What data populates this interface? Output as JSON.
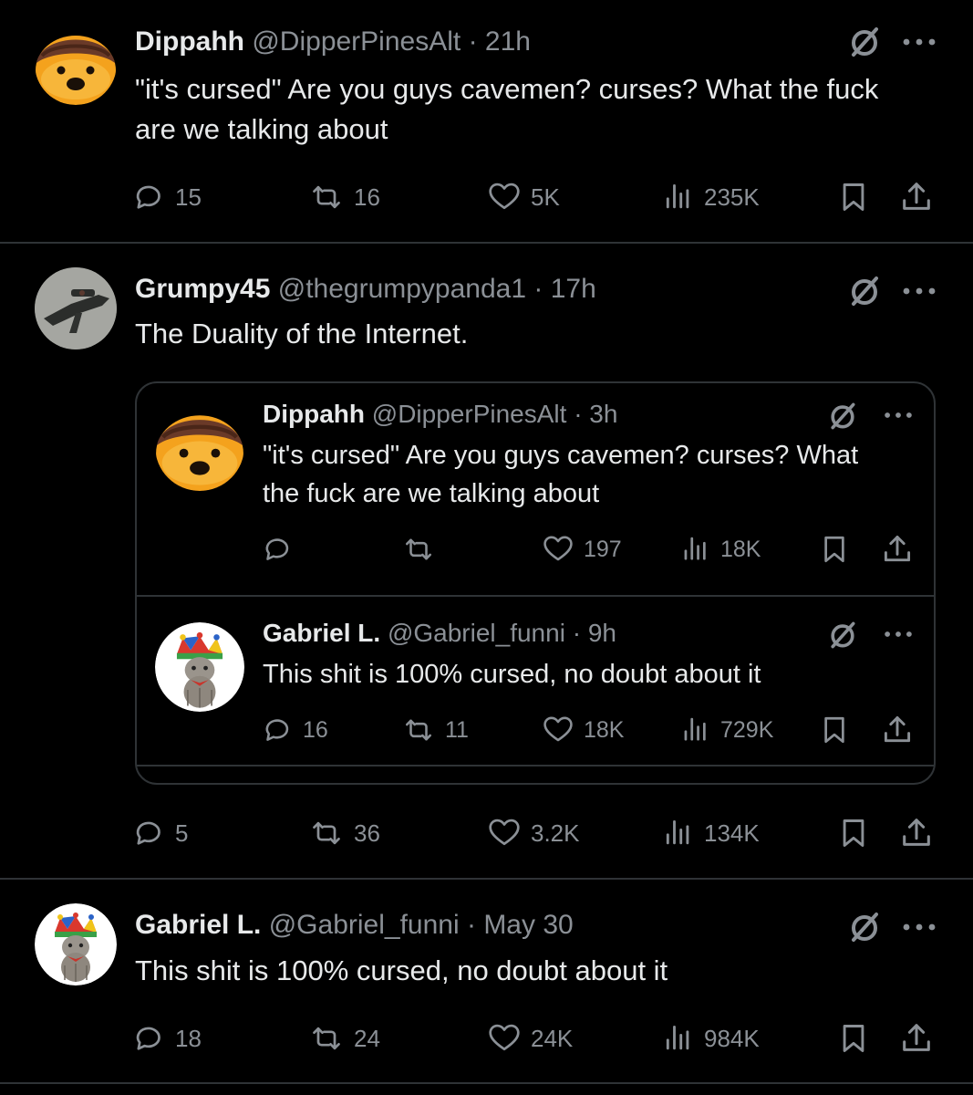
{
  "tweets": [
    {
      "name": "Dippahh",
      "handle": "@DipperPinesAlt",
      "sep": "·",
      "time": "21h",
      "text": "\"it's cursed\" Are you guys cavemen? curses? What the fuck are we talking about",
      "stats": {
        "replies": "15",
        "reposts": "16",
        "likes": "5K",
        "views": "235K"
      }
    },
    {
      "name": "Grumpy45",
      "handle": "@thegrumpypanda1",
      "sep": "·",
      "time": "17h",
      "text": "The Duality of the Internet.",
      "stats": {
        "replies": "5",
        "reposts": "36",
        "likes": "3.2K",
        "views": "134K"
      },
      "quoted": [
        {
          "name": "Dippahh",
          "handle": "@DipperPinesAlt",
          "sep": "·",
          "time": "3h",
          "text": "\"it's cursed\" Are you guys cavemen? curses? What the fuck are we talking about",
          "stats": {
            "replies": "",
            "reposts": "",
            "likes": "197",
            "views": "18K"
          }
        },
        {
          "name": "Gabriel L.",
          "handle": "@Gabriel_funni",
          "sep": "·",
          "time": "9h",
          "text": "This shit is 100% cursed, no doubt about it",
          "stats": {
            "replies": "16",
            "reposts": "11",
            "likes": "18K",
            "views": "729K"
          }
        }
      ]
    },
    {
      "name": "Gabriel L.",
      "handle": "@Gabriel_funni",
      "sep": "·",
      "time": "May 30",
      "text": "This shit is 100% cursed, no doubt about it",
      "stats": {
        "replies": "18",
        "reposts": "24",
        "likes": "24K",
        "views": "984K"
      }
    }
  ],
  "icons": {
    "reply": "speech-bubble-icon",
    "repost": "repost-arrows-icon",
    "like": "heart-icon",
    "views": "bar-chart-icon",
    "bookmark": "bookmark-icon",
    "share": "share-upload-icon",
    "grok": "slashed-circle-icon",
    "more": "ellipsis-icon"
  },
  "colors": {
    "background": "#000000",
    "text": "#e7e9ea",
    "muted": "#8b9096",
    "border": "#2f3336"
  }
}
